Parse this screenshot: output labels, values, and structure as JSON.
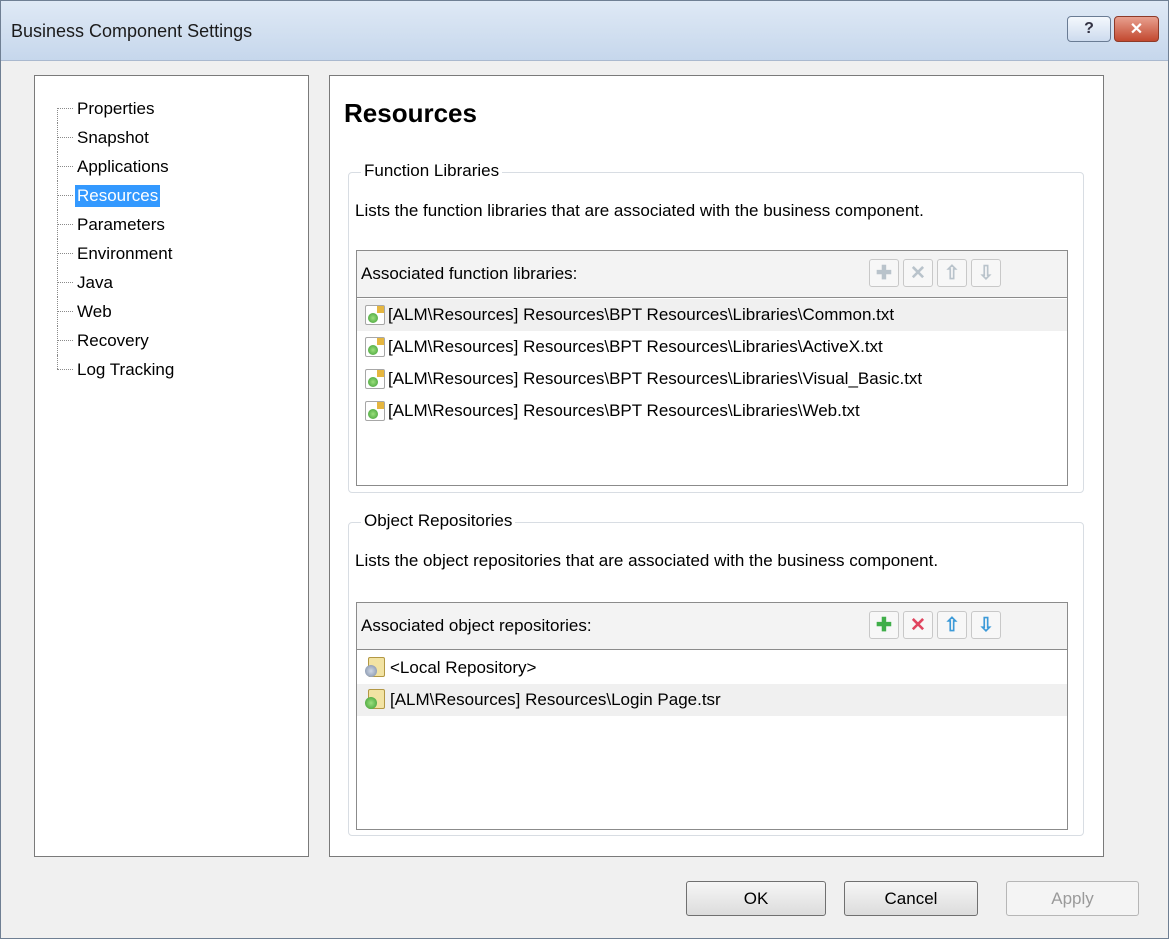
{
  "window": {
    "title": "Business Component Settings",
    "help_label": "?",
    "close_label": "✕"
  },
  "tree": {
    "items": [
      {
        "label": "Properties"
      },
      {
        "label": "Snapshot"
      },
      {
        "label": "Applications"
      },
      {
        "label": "Resources",
        "selected": true
      },
      {
        "label": "Parameters"
      },
      {
        "label": "Environment"
      },
      {
        "label": "Java"
      },
      {
        "label": "Web"
      },
      {
        "label": "Recovery"
      },
      {
        "label": "Log Tracking"
      }
    ]
  },
  "content": {
    "heading": "Resources",
    "function_libraries": {
      "group_title": "Function Libraries",
      "description": "Lists the function libraries that are associated with the business component.",
      "list_label": "Associated function libraries:",
      "toolbar": {
        "add": "✚",
        "remove": "✕",
        "up": "⇧",
        "down": "⇩"
      },
      "items": [
        "[ALM\\Resources] Resources\\BPT Resources\\Libraries\\Common.txt",
        "[ALM\\Resources] Resources\\BPT Resources\\Libraries\\ActiveX.txt",
        "[ALM\\Resources] Resources\\BPT Resources\\Libraries\\Visual_Basic.txt",
        "[ALM\\Resources] Resources\\BPT Resources\\Libraries\\Web.txt"
      ]
    },
    "object_repositories": {
      "group_title": "Object Repositories",
      "description": "Lists the object repositories that are associated with the business component.",
      "list_label": "Associated object repositories:",
      "toolbar": {
        "add": "✚",
        "remove": "✕",
        "up": "⇧",
        "down": "⇩"
      },
      "items": [
        "<Local Repository>",
        "[ALM\\Resources] Resources\\Login Page.tsr"
      ]
    }
  },
  "buttons": {
    "ok": "OK",
    "cancel": "Cancel",
    "apply": "Apply"
  },
  "colors": {
    "selection": "#3399ff",
    "add_green": "#3fae49",
    "remove_red": "#e0455f",
    "arrow_blue": "#3c9ad8"
  }
}
